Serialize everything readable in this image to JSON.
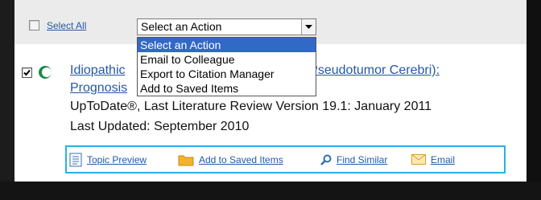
{
  "toolbar": {
    "select_all_label": "Select All",
    "action_select": {
      "value": "Select an Action",
      "options": [
        "Select an Action",
        "Email to Colleague",
        "Export to Citation Manager",
        "Add to Saved Items"
      ],
      "selected_index": 0
    }
  },
  "result": {
    "checked": true,
    "title_line1_start": "Idiopathic",
    "title_line1_end": "n (Pseudotumor Cerebri):",
    "title_line2": "Prognosis",
    "source": "UpToDate®, Last Literature Review Version 19.1: January 2011",
    "updated": "Last Updated: September 2010",
    "actions": [
      {
        "label": "Topic Preview",
        "icon": "topic-preview-icon"
      },
      {
        "label": "Add to Saved Items",
        "icon": "folder-icon"
      },
      {
        "label": "Find Similar",
        "icon": "search-icon"
      },
      {
        "label": "Email",
        "icon": "email-icon"
      }
    ]
  },
  "colors": {
    "link": "#2457a8",
    "highlight": "#3169c6",
    "actions_border": "#2ab0e8",
    "toolbar_bg": "#ebebeb"
  }
}
